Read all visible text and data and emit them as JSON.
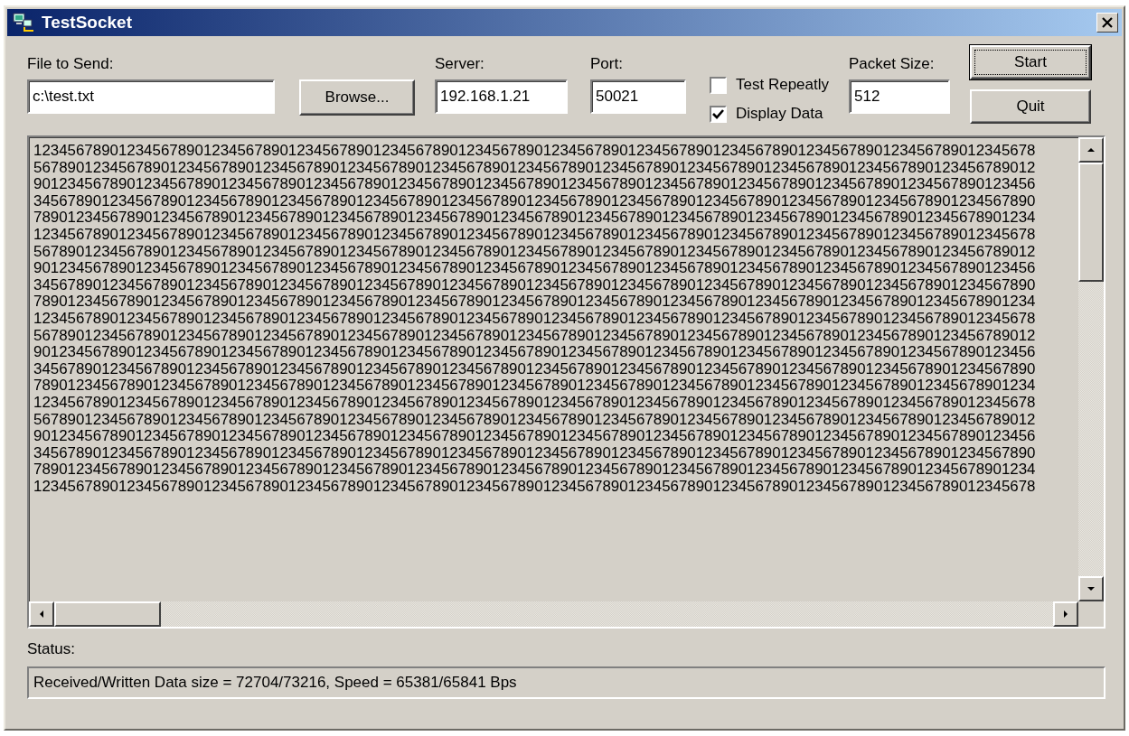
{
  "window": {
    "title": "TestSocket"
  },
  "file": {
    "label": "File to Send:",
    "value": "c:\\test.txt"
  },
  "browse_button": {
    "label": "Browse..."
  },
  "server": {
    "label": "Server:",
    "value": "192.168.1.21"
  },
  "port": {
    "label": "Port:",
    "value": "50021"
  },
  "options": [
    {
      "label": "Test Repeatly",
      "checked": false
    },
    {
      "label": "Display Data",
      "checked": true
    }
  ],
  "packet_size": {
    "label": "Packet Size:",
    "value": "512"
  },
  "buttons": [
    {
      "label": "Start",
      "focused": true
    },
    {
      "label": "Quit",
      "focused": false
    }
  ],
  "output": {
    "lines": [
      "1234567890123456789012345678901234567890123456789012345678901234567890123456789012345678901234567890123456789012345678",
      "5678901234567890123456789012345678901234567890123456789012345678901234567890123456789012345678901234567890123456789012",
      "9012345678901234567890123456789012345678901234567890123456789012345678901234567890123456789012345678901234567890123456",
      "3456789012345678901234567890123456789012345678901234567890123456789012345678901234567890123456789012345678901234567890",
      "7890123456789012345678901234567890123456789012345678901234567890123456789012345678901234567890123456789012345678901234",
      "1234567890123456789012345678901234567890123456789012345678901234567890123456789012345678901234567890123456789012345678",
      "5678901234567890123456789012345678901234567890123456789012345678901234567890123456789012345678901234567890123456789012",
      "9012345678901234567890123456789012345678901234567890123456789012345678901234567890123456789012345678901234567890123456",
      "3456789012345678901234567890123456789012345678901234567890123456789012345678901234567890123456789012345678901234567890",
      "7890123456789012345678901234567890123456789012345678901234567890123456789012345678901234567890123456789012345678901234",
      "1234567890123456789012345678901234567890123456789012345678901234567890123456789012345678901234567890123456789012345678",
      "5678901234567890123456789012345678901234567890123456789012345678901234567890123456789012345678901234567890123456789012",
      "9012345678901234567890123456789012345678901234567890123456789012345678901234567890123456789012345678901234567890123456",
      "3456789012345678901234567890123456789012345678901234567890123456789012345678901234567890123456789012345678901234567890",
      "7890123456789012345678901234567890123456789012345678901234567890123456789012345678901234567890123456789012345678901234",
      "1234567890123456789012345678901234567890123456789012345678901234567890123456789012345678901234567890123456789012345678",
      "5678901234567890123456789012345678901234567890123456789012345678901234567890123456789012345678901234567890123456789012",
      "9012345678901234567890123456789012345678901234567890123456789012345678901234567890123456789012345678901234567890123456",
      "3456789012345678901234567890123456789012345678901234567890123456789012345678901234567890123456789012345678901234567890",
      "7890123456789012345678901234567890123456789012345678901234567890123456789012345678901234567890123456789012345678901234",
      "1234567890123456789012345678901234567890123456789012345678901234567890123456789012345678901234567890123456789012345678"
    ]
  },
  "status": {
    "label": "Status:",
    "value": "Received/Written Data size = 72704/73216, Speed = 65381/65841 Bps"
  }
}
